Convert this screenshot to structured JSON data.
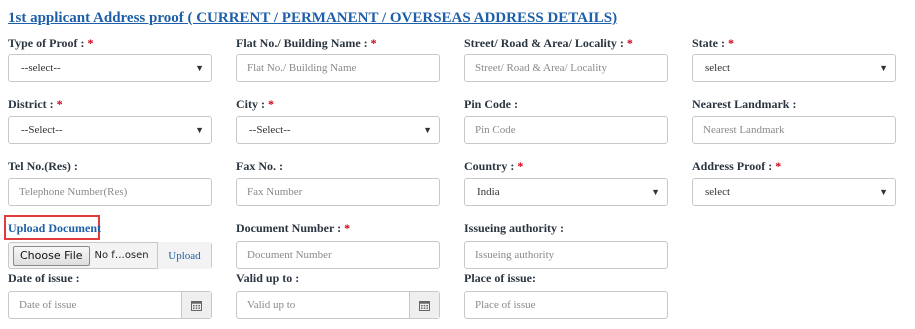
{
  "section": {
    "title": "1st applicant Address proof ( CURRENT / PERMANENT / OVERSEAS ADDRESS DETAILS)"
  },
  "fields": {
    "type_of_proof": {
      "label": "Type of Proof :",
      "value": "--select--",
      "required": "*"
    },
    "flat_no": {
      "label": "Flat No./ Building Name :",
      "placeholder": "Flat No./ Building Name",
      "required": "*"
    },
    "street": {
      "label": "Street/ Road & Area/ Locality :",
      "placeholder": "Street/ Road & Area/ Locality",
      "required": "*"
    },
    "state": {
      "label": "State :",
      "value": "select",
      "required": "*"
    },
    "district": {
      "label": "District :",
      "value": "--Select--",
      "required": "*"
    },
    "city": {
      "label": "City :",
      "value": "--Select--",
      "required": "*"
    },
    "pin_code": {
      "label": "Pin Code :",
      "placeholder": "Pin Code"
    },
    "nearest_landmark": {
      "label": "Nearest Landmark :",
      "placeholder": "Nearest Landmark"
    },
    "tel_no": {
      "label": "Tel No.(Res) :",
      "placeholder": "Telephone Number(Res)"
    },
    "fax_no": {
      "label": "Fax No. :",
      "placeholder": "Fax Number"
    },
    "country": {
      "label": "Country :",
      "value": "India",
      "required": "*"
    },
    "address_proof": {
      "label": "Address Proof :",
      "value": "select",
      "required": "*"
    },
    "upload_document": {
      "label": "Upload Document",
      "choose_label": "Choose File",
      "file_status": "No f…osen",
      "upload_label": "Upload"
    },
    "document_number": {
      "label": "Document Number :",
      "placeholder": "Document Number",
      "required": "*"
    },
    "issuing_authority": {
      "label": "Issueing authority :",
      "placeholder": "Issueing authority"
    },
    "date_of_issue": {
      "label": "Date of issue :",
      "placeholder": "Date of issue"
    },
    "valid_up_to": {
      "label": "Valid up to :",
      "placeholder": "Valid up to"
    },
    "place_of_issue": {
      "label": "Place of issue:",
      "placeholder": "Place of issue"
    }
  },
  "icons": {
    "dropdown": "caret-down-icon",
    "calendar": "calendar-icon"
  }
}
